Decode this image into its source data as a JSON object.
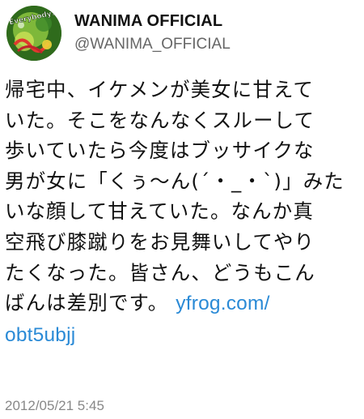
{
  "user": {
    "display_name": "WANIMA OFFICIAL",
    "handle": "@WANIMA_OFFICIAL",
    "avatar_text": "Everybody!!"
  },
  "tweet": {
    "lines": [
      "帰宅中、イケメンが美女に甘えて",
      "いた。そこをなんなくスルーして",
      "歩いていたら今度はブッサイクな",
      "男が女に「くぅ〜ん(´・_・`)」みた",
      "いな顔して甘えていた。なんか真",
      "空飛び膝蹴りをお見舞いしてやり",
      "たくなった。皆さん、どうもこん"
    ],
    "last_line_text": "ばんは差別です。",
    "link_part1": "yfrog.com/",
    "link_part2": "obt5ubjj",
    "timestamp": "2012/05/21 5:45"
  },
  "colors": {
    "link": "#2a8ad6",
    "handle": "#666666",
    "timestamp": "#888888"
  }
}
